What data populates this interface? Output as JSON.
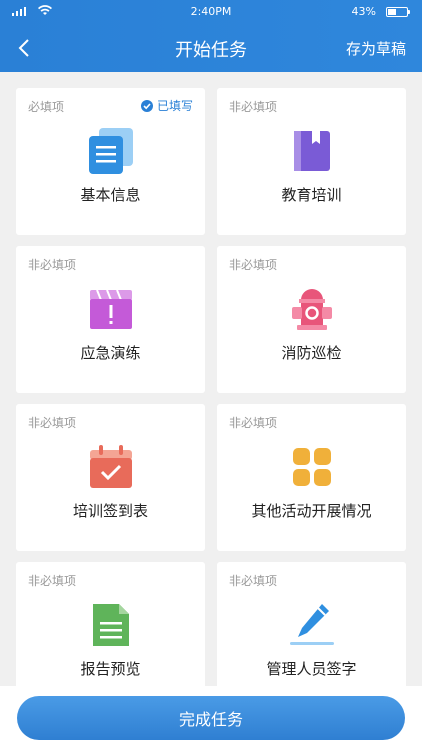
{
  "status": {
    "time": "2:40PM",
    "battery": "43%",
    "battery_level": 0.43
  },
  "nav": {
    "title": "开始任务",
    "draft": "存为草稿"
  },
  "cards": [
    {
      "req": "必填项",
      "status": "已填写",
      "label": "基本信息",
      "icon": "document-stack-icon"
    },
    {
      "req": "非必填项",
      "label": "教育培训",
      "icon": "book-icon"
    },
    {
      "req": "非必填项",
      "label": "应急演练",
      "icon": "clapperboard-alert-icon"
    },
    {
      "req": "非必填项",
      "label": "消防巡检",
      "icon": "fire-hydrant-icon"
    },
    {
      "req": "非必填项",
      "label": "培训签到表",
      "icon": "calendar-check-icon"
    },
    {
      "req": "非必填项",
      "label": "其他活动开展情况",
      "icon": "grid-tiles-icon"
    },
    {
      "req": "非必填项",
      "label": "报告预览",
      "icon": "report-document-icon"
    },
    {
      "req": "非必填项",
      "label": "管理人员签字",
      "icon": "pen-signature-icon"
    }
  ],
  "footer": {
    "complete": "完成任务"
  },
  "colors": {
    "primary": "#2a80d6",
    "doc": "#2f8fe0",
    "book": "#7a5bd6",
    "alert": "#c45ad8",
    "hydrant": "#e8557a",
    "calendar": "#e86b5a",
    "tiles": "#f0b03a",
    "report": "#5fb45a",
    "pen": "#2f8fe0"
  }
}
